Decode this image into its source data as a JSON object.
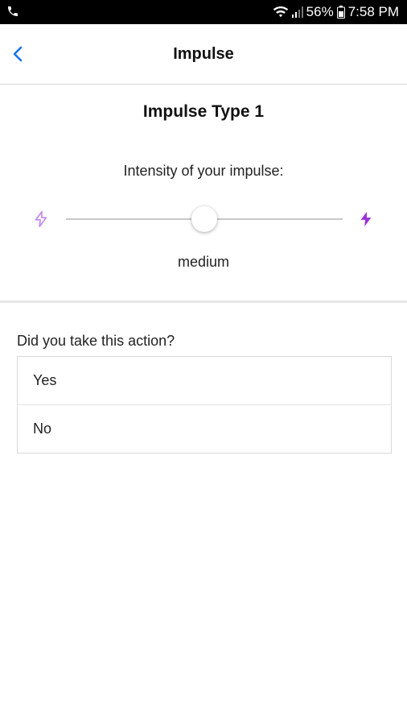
{
  "status_bar": {
    "battery": "56%",
    "time": "7:58 PM",
    "icons": [
      "phone-icon",
      "wifi-icon",
      "signal-icon",
      "battery-icon"
    ]
  },
  "header": {
    "title": "Impulse",
    "back_icon": "chevron-left-icon"
  },
  "impulse": {
    "type_title": "Impulse Type 1",
    "intensity_label": "Intensity of your impulse:",
    "intensity_value_label": "medium",
    "intensity_level": 0.5,
    "low_icon": "lightning-outline-icon",
    "high_icon": "lightning-filled-icon"
  },
  "action": {
    "question": "Did you take this action?",
    "options": [
      "Yes",
      "No"
    ]
  },
  "colors": {
    "accent": "#1a73e8",
    "bolt": "#9b30d9",
    "bolt_light": "#c387ea"
  }
}
